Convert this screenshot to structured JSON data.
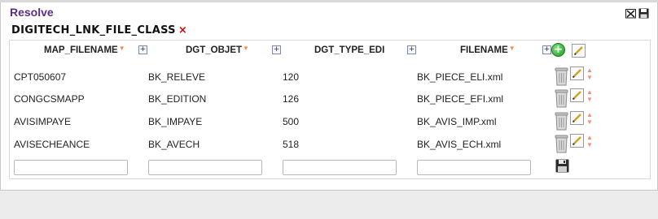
{
  "panel": {
    "title": "Resolve"
  },
  "entity": {
    "title": "DIGITECH_LNK_FILE_CLASS",
    "close": "×"
  },
  "columns": [
    {
      "label": "MAP_FILENAME"
    },
    {
      "label": "DGT_OBJET"
    },
    {
      "label": "DGT_TYPE_EDI"
    },
    {
      "label": "FILENAME"
    }
  ],
  "sort_glyph": "▼",
  "plus_glyph": "+",
  "move_up": "▲",
  "move_down": "▼",
  "rows": [
    {
      "map_filename": "CPT050607",
      "dgt_objet": "BK_RELEVE",
      "dgt_type_edi": "120",
      "filename": "BK_PIECE_ELI.xml"
    },
    {
      "map_filename": "CONGCSMAPP",
      "dgt_objet": "BK_EDITION",
      "dgt_type_edi": "126",
      "filename": "BK_PIECE_EFI.xml"
    },
    {
      "map_filename": "AVISIMPAYE",
      "dgt_objet": "BK_IMPAYE",
      "dgt_type_edi": "500",
      "filename": "BK_AVIS_IMP.xml"
    },
    {
      "map_filename": "AVISECHEANCE",
      "dgt_objet": "BK_AVECH",
      "dgt_type_edi": "518",
      "filename": "BK_AVIS_ECH.xml"
    }
  ],
  "new_row": {
    "map_filename": "",
    "dgt_objet": "",
    "dgt_type_edi": "",
    "filename": ""
  },
  "icons": {
    "window": [
      "close-all-icon",
      "save-all-icon"
    ],
    "add": "add-circle-icon",
    "edit": "pencil-icon",
    "delete": "trash-icon",
    "save": "floppy-disk-icon"
  },
  "colors": {
    "title": "#5b2d87",
    "close": "#e00000",
    "sort": "#f08a5d",
    "add": "#1e9a1e"
  }
}
